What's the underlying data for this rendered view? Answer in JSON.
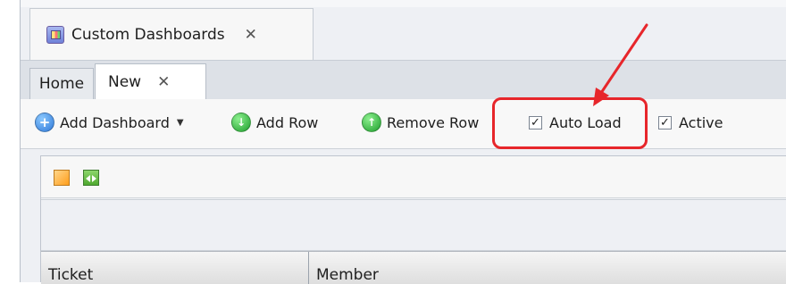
{
  "window_tab": {
    "title": "Custom Dashboards",
    "close_symbol": "✕",
    "icon": "dashboard-icon"
  },
  "doc_tabs": [
    {
      "label": "Home",
      "active": false
    },
    {
      "label": "New",
      "active": true,
      "close_symbol": "✕"
    }
  ],
  "toolbar": {
    "add_dashboard": {
      "label": "Add Dashboard",
      "icon": "add-dashboard-icon",
      "dropdown_symbol": "▼"
    },
    "add_row": {
      "label": "Add Row",
      "icon": "add-row-icon"
    },
    "remove_row": {
      "label": "Remove Row",
      "icon": "remove-row-icon"
    },
    "auto_load": {
      "label": "Auto Load",
      "checked": true
    },
    "active": {
      "label": "Active",
      "checked": true
    }
  },
  "annotation": {
    "color": "#e7262b"
  },
  "grid": {
    "columns": [
      "Ticket",
      "Member"
    ]
  }
}
